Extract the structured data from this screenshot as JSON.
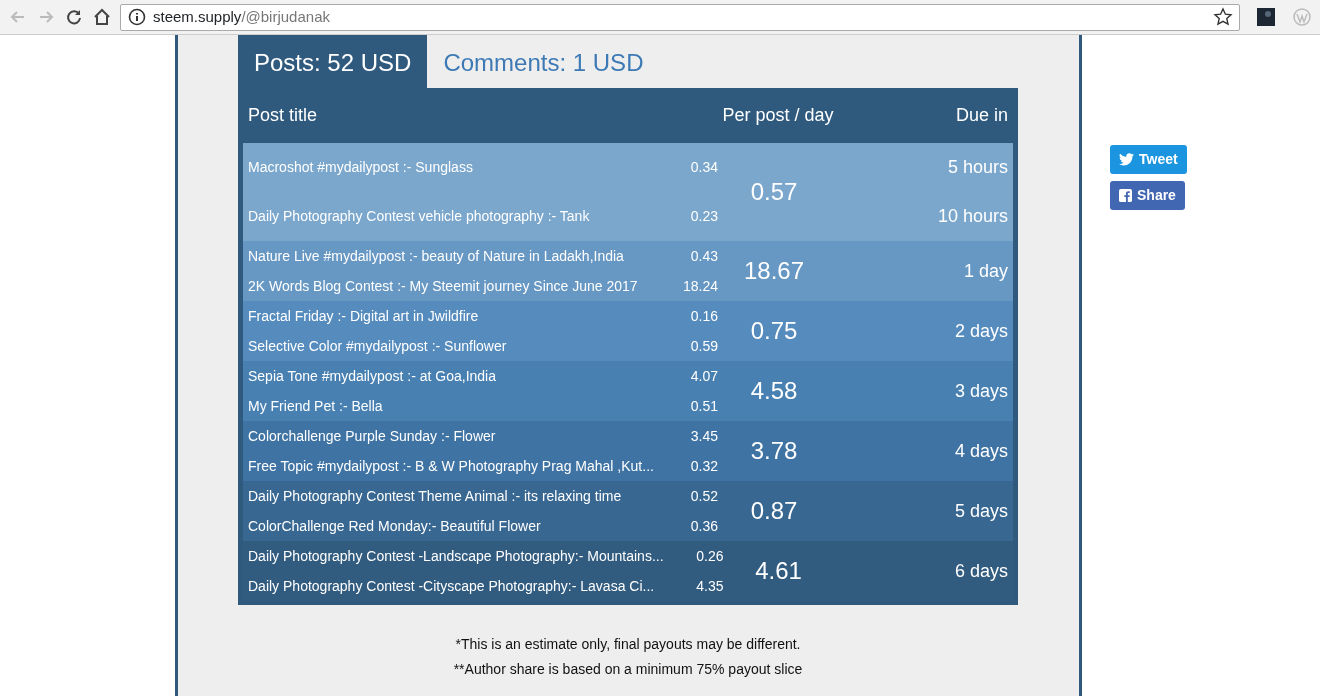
{
  "browser": {
    "url_host": "steem.supply",
    "url_path": "/@birjudanak"
  },
  "tabs": [
    {
      "label": "Posts: 52 USD",
      "selected": true
    },
    {
      "label": "Comments: 1 USD",
      "selected": false
    }
  ],
  "table": {
    "columns": [
      "Post title",
      "Per post / day",
      "Due in"
    ],
    "groups": [
      {
        "color": "#7ba7cc",
        "total": "0.57",
        "posts": [
          {
            "title": "Macroshot #mydailypost :- Sunglass",
            "value": "0.34",
            "due": "5 hours"
          },
          {
            "title": "Daily Photography Contest vehicle photography :- Tank",
            "value": "0.23",
            "due": "10 hours"
          }
        ]
      },
      {
        "color": "#6797c3",
        "total": "18.67",
        "due": "1 day",
        "posts": [
          {
            "title": "Nature Live #mydailypost :- beauty of Nature in Ladakh,India",
            "value": "0.43"
          },
          {
            "title": "2K Words Blog Contest :- My Steemit journey Since June 2017",
            "value": "18.24"
          }
        ]
      },
      {
        "color": "#568cbd",
        "total": "0.75",
        "due": "2 days",
        "posts": [
          {
            "title": "Fractal Friday :- Digital art in Jwildfire",
            "value": "0.16"
          },
          {
            "title": "Selective Color #mydailypost :- Sunflower",
            "value": "0.59"
          }
        ]
      },
      {
        "color": "#4880b2",
        "total": "4.58",
        "due": "3 days",
        "posts": [
          {
            "title": "Sepia Tone #mydailypost :- at Goa,India",
            "value": "4.07"
          },
          {
            "title": "My Friend Pet :- Bella",
            "value": "0.51"
          }
        ]
      },
      {
        "color": "#3f73a3",
        "total": "3.78",
        "due": "4 days",
        "posts": [
          {
            "title": "Colorchallenge Purple Sunday :- Flower",
            "value": "3.45"
          },
          {
            "title": "Free Topic #mydailypost :- B & W Photography Prag Mahal ,Kut...",
            "value": "0.32"
          }
        ]
      },
      {
        "color": "#386791",
        "total": "0.87",
        "due": "5 days",
        "posts": [
          {
            "title": "Daily Photography Contest Theme Animal :- its relaxing time",
            "value": "0.52"
          },
          {
            "title": "ColorChallenge Red Monday:- Beautiful Flower",
            "value": "0.36"
          }
        ]
      },
      {
        "color": "#315b7f",
        "total": "4.61",
        "due": "6 days",
        "posts": [
          {
            "title": "Daily Photography Contest -Landscape Photography:- Mountains...",
            "value": "0.26"
          },
          {
            "title": "Daily Photography Contest -Cityscape Photography:- Lavasa Ci...",
            "value": "4.35"
          }
        ]
      }
    ]
  },
  "notes": [
    "*This is an estimate only, final payouts may be different.",
    "**Author share is based on a minimum 75% payout slice"
  ],
  "share": [
    {
      "kind": "twitter",
      "label": "Tweet"
    },
    {
      "kind": "facebook",
      "label": "Share"
    }
  ]
}
